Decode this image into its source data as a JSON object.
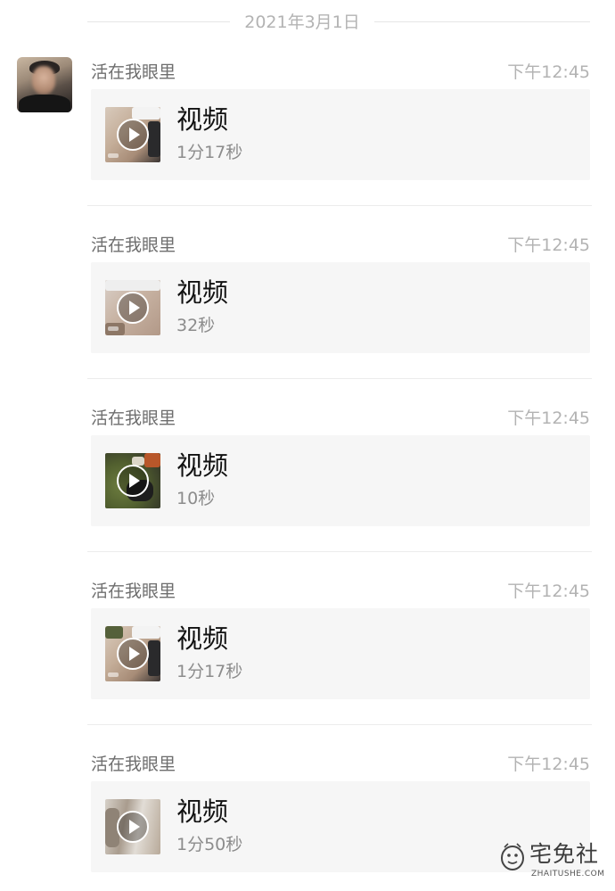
{
  "date_header": "2021年3月1日",
  "messages": [
    {
      "sender": "活在我眼里",
      "time": "下午12:45",
      "title": "视频",
      "duration": "1分17秒"
    },
    {
      "sender": "活在我眼里",
      "time": "下午12:45",
      "title": "视频",
      "duration": "32秒"
    },
    {
      "sender": "活在我眼里",
      "time": "下午12:45",
      "title": "视频",
      "duration": "10秒"
    },
    {
      "sender": "活在我眼里",
      "time": "下午12:45",
      "title": "视频",
      "duration": "1分17秒"
    },
    {
      "sender": "活在我眼里",
      "time": "下午12:45",
      "title": "视频",
      "duration": "1分50秒"
    }
  ],
  "watermark": {
    "text": "宅免社",
    "subtext": "ZHAITUSHE.COM"
  },
  "icons": {
    "play": "play-icon",
    "avatar": "avatar-photo"
  },
  "colors": {
    "card_background": "#f6f6f6",
    "muted_text": "#b3b3b3",
    "sender_text": "#6e6e6e"
  }
}
